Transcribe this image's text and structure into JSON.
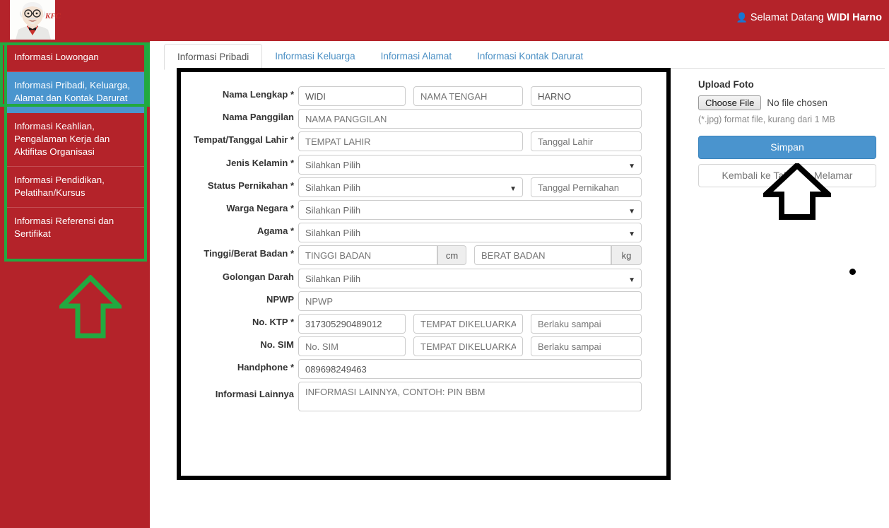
{
  "header": {
    "user_icon": "user-icon",
    "greeting": "Selamat Datang ",
    "username": "WIDI Harno",
    "logo_text": "KFC",
    "brand_red": "#b4232a"
  },
  "sidebar": {
    "items": [
      {
        "label": "Informasi Lowongan",
        "active": false
      },
      {
        "label": "Informasi Pribadi, Keluarga, Alamat dan Kontak Darurat",
        "active": true
      },
      {
        "label": "Informasi Keahlian, Pengalaman Kerja dan Aktifitas Organisasi",
        "active": false
      },
      {
        "label": "Informasi Pendidikan, Pelatihan/Kursus",
        "active": false
      },
      {
        "label": "Informasi Referensi dan Sertifikat",
        "active": false
      }
    ],
    "highlight_color": "#22a940",
    "active_color": "#4a95ce"
  },
  "tabs": [
    {
      "label": "Informasi Pribadi",
      "active": true
    },
    {
      "label": "Informasi Keluarga",
      "active": false
    },
    {
      "label": "Informasi Alamat",
      "active": false
    },
    {
      "label": "Informasi Kontak Darurat",
      "active": false
    }
  ],
  "form": {
    "required_mark": "*",
    "select_placeholder": "Silahkan Pilih",
    "caret": "▼",
    "fields": {
      "nama_lengkap": {
        "label": "Nama Lengkap",
        "required": true,
        "first_value": "WIDI",
        "middle_placeholder": "NAMA TENGAH",
        "last_value": "HARNO"
      },
      "nama_panggilan": {
        "label": "Nama Panggilan",
        "required": false,
        "placeholder": "NAMA PANGGILAN"
      },
      "tempat_tanggal_lahir": {
        "label": "Tempat/Tanggal Lahir",
        "required": true,
        "place_placeholder": "TEMPAT LAHIR",
        "date_placeholder": "Tanggal Lahir"
      },
      "jenis_kelamin": {
        "label": "Jenis Kelamin",
        "required": true,
        "value": "Silahkan Pilih"
      },
      "status_pernikahan": {
        "label": "Status Pernikahan",
        "required": true,
        "value": "Silahkan Pilih",
        "date_placeholder": "Tanggal Pernikahan"
      },
      "warga_negara": {
        "label": "Warga Negara",
        "required": true,
        "value": "Silahkan Pilih"
      },
      "agama": {
        "label": "Agama",
        "required": true,
        "value": "Silahkan Pilih"
      },
      "tinggi_berat_badan": {
        "label": "Tinggi/Berat Badan",
        "required": true,
        "height_placeholder": "TINGGI BADAN",
        "height_unit": "cm",
        "weight_placeholder": "BERAT BADAN",
        "weight_unit": "kg"
      },
      "golongan_darah": {
        "label": "Golongan Darah",
        "required": false,
        "value": "Silahkan Pilih"
      },
      "npwp": {
        "label": "NPWP",
        "required": false,
        "placeholder": "NPWP"
      },
      "no_ktp": {
        "label": "No. KTP",
        "required": true,
        "value": "317305290489012",
        "issued_placeholder": "TEMPAT DIKELUARKAN",
        "valid_placeholder": "Berlaku sampai"
      },
      "no_sim": {
        "label": "No. SIM",
        "required": false,
        "placeholder": "No. SIM",
        "issued_placeholder": "TEMPAT DIKELUARKAN",
        "valid_placeholder": "Berlaku sampai"
      },
      "handphone": {
        "label": "Handphone",
        "required": true,
        "value": "089698249463"
      },
      "informasi_lainnya": {
        "label": "Informasi Lainnya",
        "required": false,
        "placeholder": "INFORMASI LAINNYA, CONTOH: PIN BBM"
      }
    }
  },
  "right_panel": {
    "upload_title": "Upload Foto",
    "choose_file_label": "Choose File",
    "no_file_text": "No file chosen",
    "hint": "(*.jpg) format file, kurang dari 1 MB",
    "save_label": "Simpan",
    "back_label": "Kembali ke Tahapan Melamar",
    "save_color": "#4a94ce"
  },
  "annotations": {
    "form_box_color": "#000000",
    "sidebar_box_color": "#22a940",
    "arrow_up_green": "arrow-up-icon",
    "arrow_up_black": "arrow-up-icon",
    "cursor_dot": "cursor-dot"
  }
}
